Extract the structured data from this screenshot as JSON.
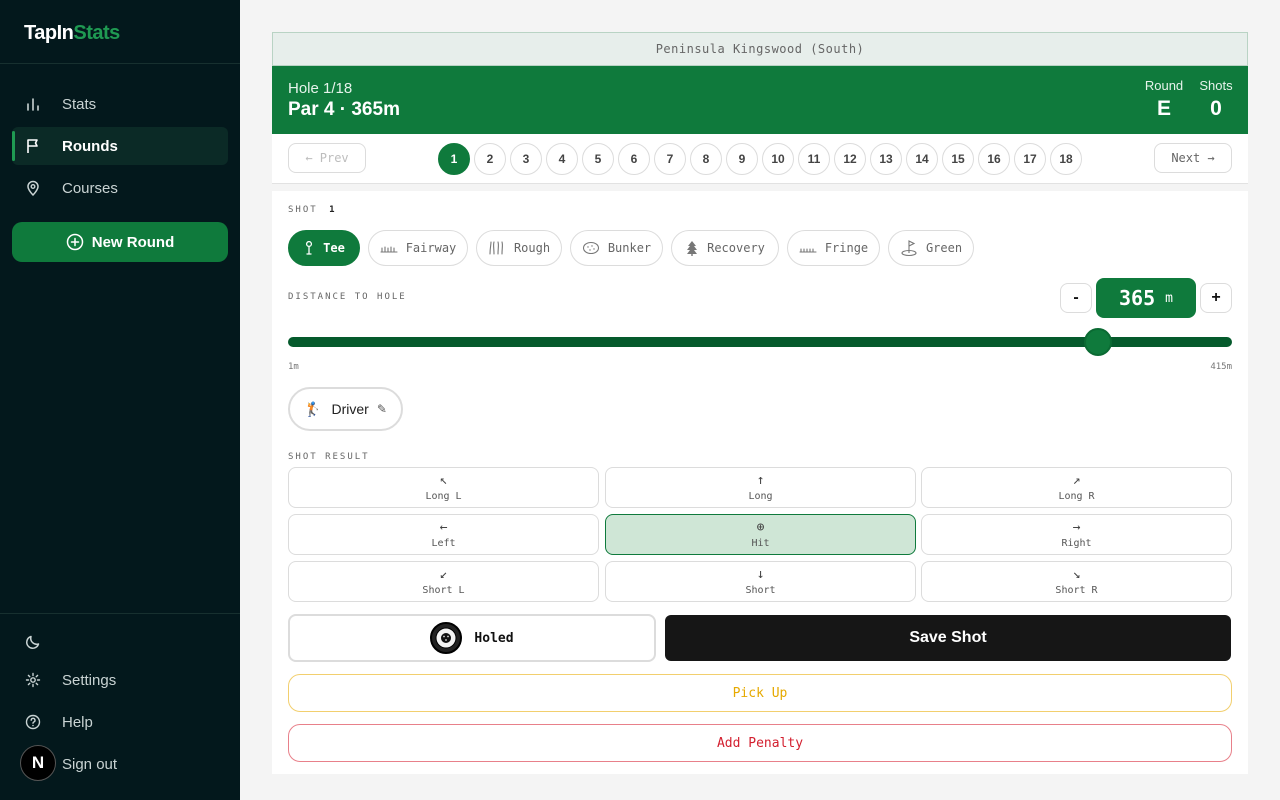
{
  "app": {
    "logo_part1": "TapIn",
    "logo_part2": "Stats"
  },
  "sidebar": {
    "nav": [
      {
        "label": "Stats",
        "icon": "bar-chart-icon"
      },
      {
        "label": "Rounds",
        "icon": "flag-icon",
        "active": true
      },
      {
        "label": "Courses",
        "icon": "map-pin-icon"
      }
    ],
    "new_round_label": "New Round",
    "bottom": [
      {
        "label": "",
        "icon": "moon-icon"
      },
      {
        "label": "Settings",
        "icon": "gear-icon"
      },
      {
        "label": "Help",
        "icon": "help-circle-icon"
      },
      {
        "label": "Sign out",
        "icon": "sign-out-icon"
      }
    ],
    "avatar_letter": "N"
  },
  "course": {
    "name": "Peninsula Kingswood (South)"
  },
  "hole": {
    "label": "Hole 1/18",
    "par_line": "Par 4 · 365m",
    "round_label": "Round",
    "round_value": "E",
    "shots_label": "Shots",
    "shots_value": "0"
  },
  "hole_nav": {
    "prev_label": "← Prev",
    "next_label": "Next →",
    "holes": [
      "1",
      "2",
      "3",
      "4",
      "5",
      "6",
      "7",
      "8",
      "9",
      "10",
      "11",
      "12",
      "13",
      "14",
      "15",
      "16",
      "17",
      "18"
    ],
    "active_hole": "1"
  },
  "shot": {
    "label": "SHOT",
    "number": "1",
    "lies": [
      {
        "label": "Tee",
        "icon": "tee-icon",
        "active": true
      },
      {
        "label": "Fairway",
        "icon": "fairway-icon"
      },
      {
        "label": "Rough",
        "icon": "rough-icon"
      },
      {
        "label": "Bunker",
        "icon": "bunker-icon"
      },
      {
        "label": "Recovery",
        "icon": "tree-icon"
      },
      {
        "label": "Fringe",
        "icon": "fringe-icon"
      },
      {
        "label": "Green",
        "icon": "green-flag-icon"
      }
    ],
    "distance_label": "DISTANCE TO HOLE",
    "distance_value": "365",
    "distance_unit": "m",
    "minus": "-",
    "plus": "+",
    "slider_min": "1m",
    "slider_max": "415m",
    "slider_min_value": 1,
    "slider_max_value": 415,
    "slider_value": 365,
    "club_label": "Driver",
    "club_icon": "golfer-icon",
    "club_edit_icon": "pencil-icon"
  },
  "result": {
    "label": "SHOT RESULT",
    "options": [
      {
        "label": "Long L",
        "arrow": "↖"
      },
      {
        "label": "Long",
        "arrow": "↑"
      },
      {
        "label": "Long R",
        "arrow": "↗"
      },
      {
        "label": "Left",
        "arrow": "←"
      },
      {
        "label": "Hit",
        "arrow": "⊕",
        "active": true
      },
      {
        "label": "Right",
        "arrow": "→"
      },
      {
        "label": "Short L",
        "arrow": "↙"
      },
      {
        "label": "Short",
        "arrow": "↓"
      },
      {
        "label": "Short R",
        "arrow": "↘"
      }
    ]
  },
  "actions": {
    "holed_label": "Holed",
    "save_label": "Save Shot",
    "pickup_label": "Pick Up",
    "penalty_label": "Add Penalty"
  },
  "colors": {
    "brand_green": "#0f7a3c",
    "sidebar_bg": "#03181c",
    "pickup": "#e6a900",
    "penalty": "#d31f2f"
  }
}
